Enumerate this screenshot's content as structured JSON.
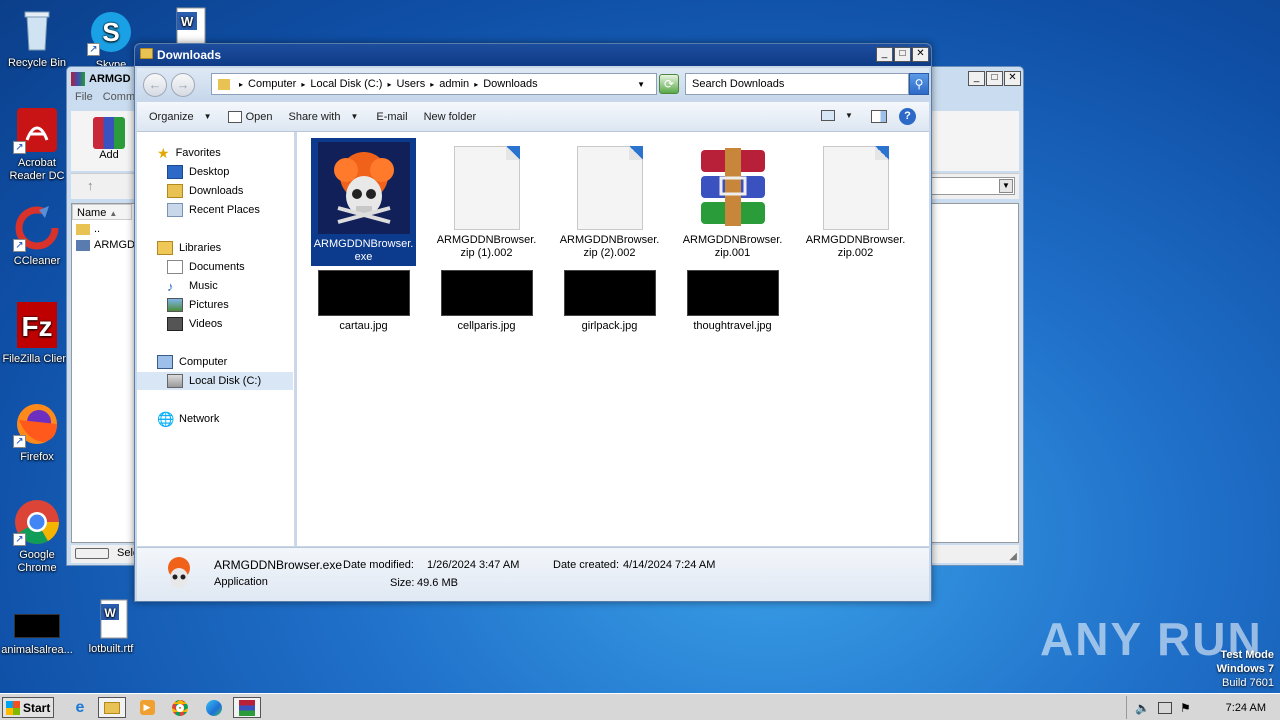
{
  "desktop": {
    "icons": [
      {
        "label": "Recycle Bin"
      },
      {
        "label": "Skype"
      },
      {
        "label": "Acrobat Reader DC"
      },
      {
        "label": "CCleaner"
      },
      {
        "label": "FileZilla Client"
      },
      {
        "label": "Firefox"
      },
      {
        "label": "Google Chrome"
      },
      {
        "label": "animalsalrea..."
      },
      {
        "label": "lotbuilt.rtf"
      }
    ]
  },
  "rar": {
    "title": "ARMGD",
    "menu": [
      "File",
      "Comm"
    ],
    "add_label": "Add",
    "col_name": "Name",
    "rows": [
      "..",
      "ARMGD"
    ],
    "status": "Sele"
  },
  "explorer": {
    "title": "Downloads",
    "breadcrumb": [
      "Computer",
      "Local Disk (C:)",
      "Users",
      "admin",
      "Downloads"
    ],
    "search_placeholder": "Search Downloads",
    "commands": {
      "organize": "Organize",
      "open": "Open",
      "share": "Share with",
      "email": "E-mail",
      "new_folder": "New folder"
    },
    "nav": {
      "favorites": "Favorites",
      "desktop": "Desktop",
      "downloads": "Downloads",
      "recent": "Recent Places",
      "libraries": "Libraries",
      "documents": "Documents",
      "music": "Music",
      "pictures": "Pictures",
      "videos": "Videos",
      "computer": "Computer",
      "local_disk": "Local Disk (C:)",
      "network": "Network"
    },
    "files": [
      {
        "name": "ARMGDDNBrowser.exe",
        "line1": "ARMGDDNBrowser.",
        "line2": "exe"
      },
      {
        "name": "ARMGDDNBrowser.zip (1).002",
        "line1": "ARMGDDNBrowser.",
        "line2": "zip (1).002"
      },
      {
        "name": "ARMGDDNBrowser.zip (2).002",
        "line1": "ARMGDDNBrowser.",
        "line2": "zip (2).002"
      },
      {
        "name": "ARMGDDNBrowser.zip.001",
        "line1": "ARMGDDNBrowser.",
        "line2": "zip.001"
      },
      {
        "name": "ARMGDDNBrowser.zip.002",
        "line1": "ARMGDDNBrowser.",
        "line2": "zip.002"
      },
      {
        "name": "cartau.jpg"
      },
      {
        "name": "cellparis.jpg"
      },
      {
        "name": "girlpack.jpg"
      },
      {
        "name": "thoughtravel.jpg"
      }
    ],
    "details": {
      "filename": "ARMGDDNBrowser.exe",
      "type": "Application",
      "modified_label": "Date modified:",
      "modified": "1/26/2024 3:47 AM",
      "size_label": "Size:",
      "size": "49.6 MB",
      "created_label": "Date created:",
      "created": "4/14/2024 7:24 AM"
    }
  },
  "taskbar": {
    "start": "Start",
    "clock": "7:24 AM"
  },
  "watermark": "ANY RUN",
  "testmode": {
    "line1": "Test Mode",
    "line2": "Windows 7",
    "line3": "Build 7601"
  },
  "colors": {
    "desktop": "#1f6fc8",
    "titlebar": "#0f3b86",
    "selection": "#0c3a8c"
  }
}
